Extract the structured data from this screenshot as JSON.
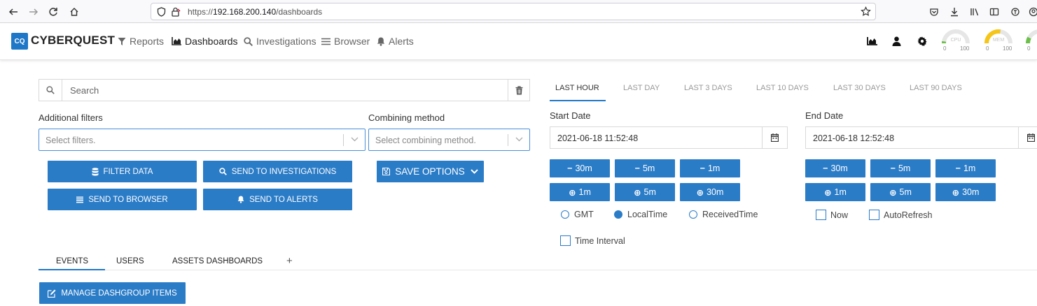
{
  "browser": {
    "url_prefix": "https://",
    "url_host": "192.168.200.140",
    "url_path": "/dashboards"
  },
  "app": {
    "logo_abbr": "CQ",
    "logo_name": "CYBERQUEST",
    "nav": [
      {
        "label": "Reports",
        "icon": "filter-icon"
      },
      {
        "label": "Dashboards",
        "icon": "chart-icon"
      },
      {
        "label": "Investigations",
        "icon": "search-icon"
      },
      {
        "label": "Browser",
        "icon": "list-icon"
      },
      {
        "label": "Alerts",
        "icon": "bell-icon"
      }
    ],
    "gauges": [
      {
        "label": "CPU",
        "min": "0",
        "max": "100",
        "color": "#6cc04a",
        "level": 0.05
      },
      {
        "label": "MEM",
        "min": "0",
        "max": "100",
        "color": "#f5c518",
        "level": 0.55
      }
    ],
    "gauge3_min": "0"
  },
  "filters": {
    "search_placeholder": "Search",
    "additional_label": "Additional filters",
    "additional_placeholder": "Select filters.",
    "combining_label": "Combining method",
    "combining_placeholder": "Select combining method.",
    "buttons": {
      "filter_data": "FILTER DATA",
      "send_investigations": "SEND TO INVESTIGATIONS",
      "send_browser": "SEND TO BROWSER",
      "send_alerts": "SEND TO ALERTS",
      "save_options": "SAVE OPTIONS"
    }
  },
  "time": {
    "ranges": [
      "LAST HOUR",
      "LAST DAY",
      "LAST 3 DAYS",
      "LAST 10 DAYS",
      "LAST 30 DAYS",
      "LAST 90 DAYS"
    ],
    "active_range": "LAST HOUR",
    "start_label": "Start Date",
    "start_value": "2021-06-18 11:52:48",
    "end_label": "End Date",
    "end_value": "2021-06-18 12:52:48",
    "minus_steps": [
      "30m",
      "5m",
      "1m"
    ],
    "plus_steps": [
      "1m",
      "5m",
      "30m"
    ],
    "timezone_options": [
      "GMT",
      "LocalTime",
      "ReceivedTime"
    ],
    "timezone_selected": "LocalTime",
    "now_label": "Now",
    "autorefresh_label": "AutoRefresh",
    "interval_label": "Time Interval"
  },
  "dashtabs": {
    "tabs": [
      "EVENTS",
      "USERS",
      "ASSETS DASHBOARDS"
    ],
    "active": "EVENTS",
    "add_label": "+",
    "manage_label": "MANAGE DASHGROUP ITEMS"
  }
}
